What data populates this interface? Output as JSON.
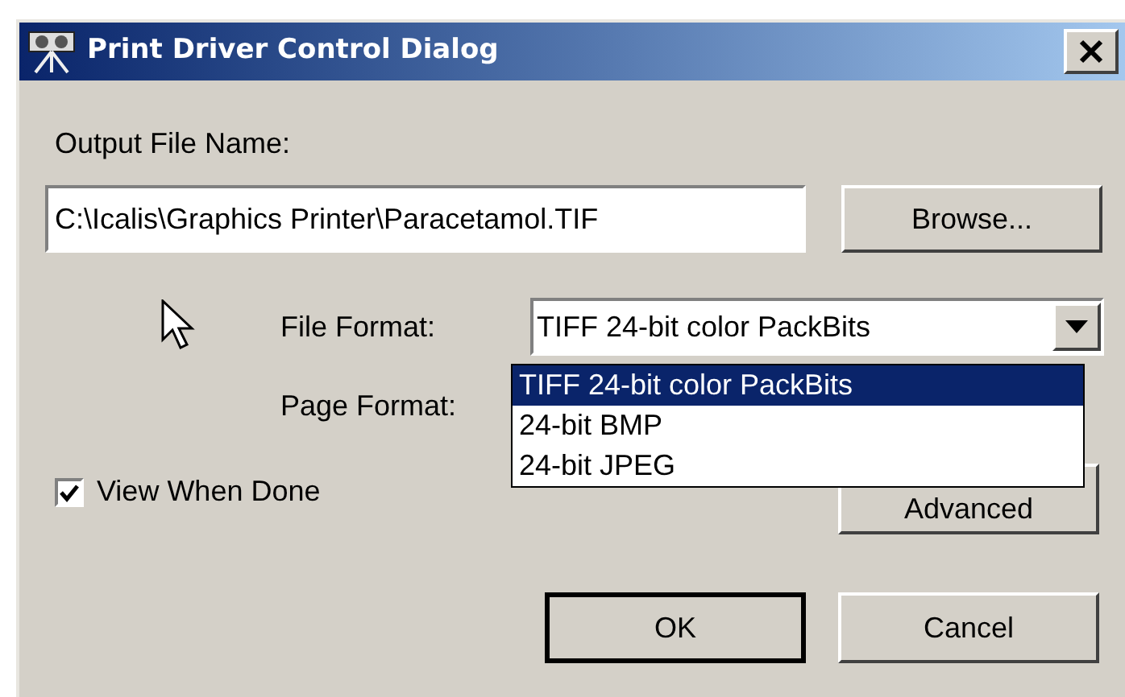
{
  "window": {
    "title": "Print Driver Control Dialog"
  },
  "output_file": {
    "label": "Output File Name:",
    "value": "C:\\Icalis\\Graphics Printer\\Paracetamol.TIF",
    "button": "Browse..."
  },
  "file_format": {
    "label": "File Format:",
    "value": "TIFF 24-bit color PackBits",
    "expanded": true,
    "options": [
      {
        "label": "TIFF 24-bit color PackBits",
        "selected": true
      },
      {
        "label": "24-bit BMP",
        "selected": false
      },
      {
        "label": "24-bit JPEG",
        "selected": false
      }
    ]
  },
  "page_format": {
    "label": "Page Format:"
  },
  "view_when_done": {
    "label": "View When Done",
    "checked": true
  },
  "advanced_button": "Advanced",
  "buttons": [
    {
      "label": "OK",
      "default": true
    },
    {
      "label": "Cancel",
      "default": false
    }
  ]
}
